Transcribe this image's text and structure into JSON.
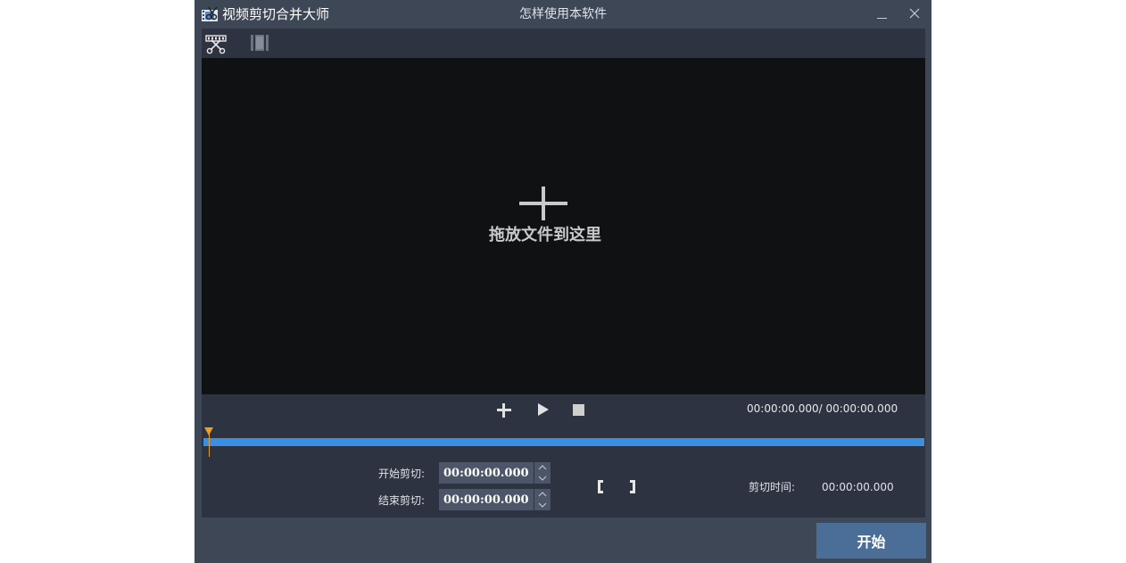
{
  "window": {
    "app_title": "视频剪切合并大师",
    "help_link": "怎样使用本软件"
  },
  "icons": {
    "app": "film-scissors-icon",
    "minimize": "minimize-icon",
    "close": "close-icon",
    "tool_cut": "film-cut-icon",
    "tool_merge": "film-merge-icon",
    "add": "plus-icon",
    "play": "play-icon",
    "stop": "stop-icon"
  },
  "preview": {
    "drop_text": "拖放文件到这里"
  },
  "player": {
    "time_readout": "00:00:00.000/ 00:00:00.000",
    "progress": 0
  },
  "cut": {
    "start_label": "开始剪切:",
    "start_value": "00:00:00.000",
    "end_label": "结束剪切:",
    "end_value": "00:00:00.000",
    "duration_label": "剪切时间:",
    "duration_value": "00:00:00.000"
  },
  "actions": {
    "start_button": "开始"
  },
  "colors": {
    "window_bg": "#3e4756",
    "panel_bg": "#2d3340",
    "preview_bg": "#101113",
    "track": "#3a8fe2",
    "playhead": "#f0a020",
    "start_button": "#4b6e98"
  }
}
